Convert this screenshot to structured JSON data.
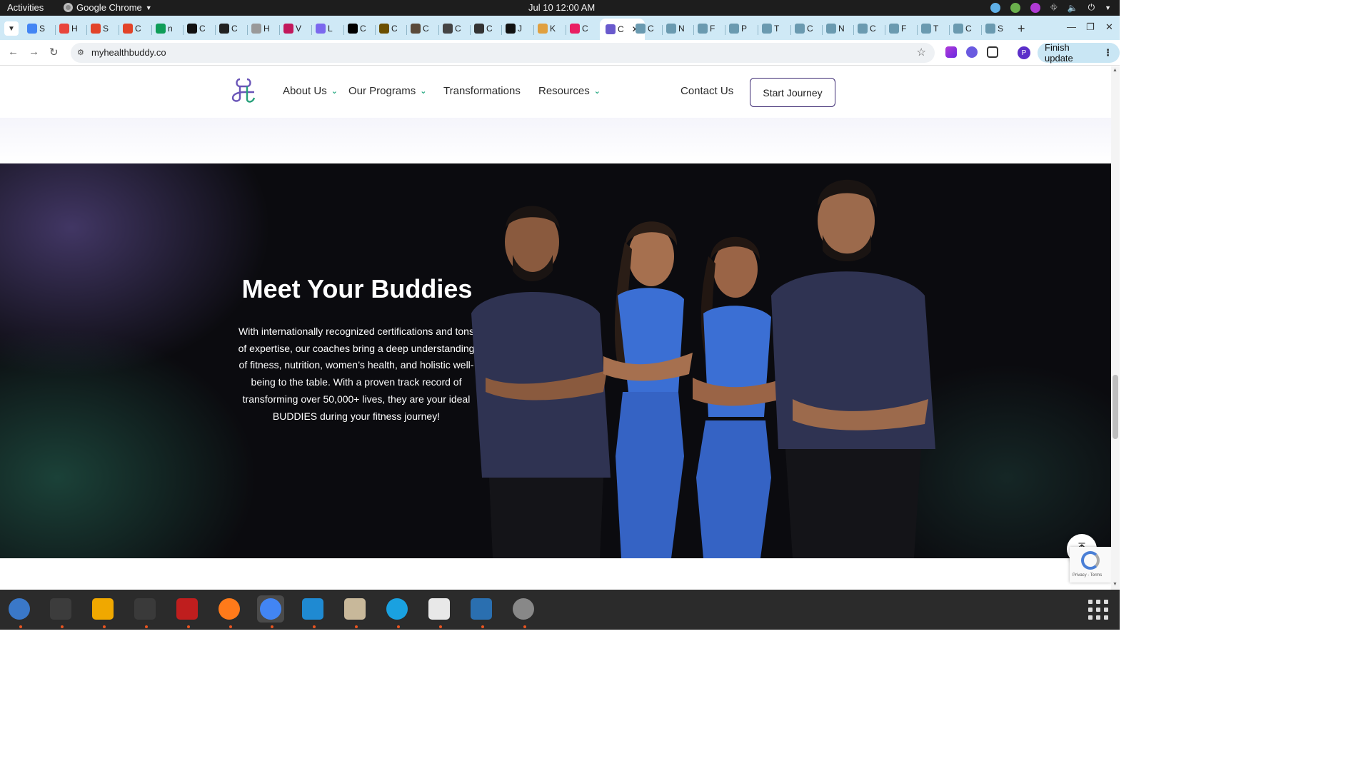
{
  "system": {
    "activities": "Activities",
    "app_menu": "Google Chrome",
    "clock": "Jul 10  12:00 AM"
  },
  "tabs": [
    {
      "letter": "S",
      "color": "#4285f4"
    },
    {
      "letter": "H",
      "color": "#e8453c"
    },
    {
      "letter": "S",
      "color": "#e24329"
    },
    {
      "letter": "C",
      "color": "#e24329"
    },
    {
      "letter": "n",
      "color": "#0f9d58"
    },
    {
      "letter": "C",
      "color": "#111111"
    },
    {
      "letter": "C",
      "color": "#222222"
    },
    {
      "letter": "H",
      "color": "#999999"
    },
    {
      "letter": "V",
      "color": "#c2185b"
    },
    {
      "letter": "L",
      "color": "#7b68ee"
    },
    {
      "letter": "C",
      "color": "#000000"
    },
    {
      "letter": "C",
      "color": "#6b4f00"
    },
    {
      "letter": "C",
      "color": "#5a4a3a"
    },
    {
      "letter": "C",
      "color": "#444444"
    },
    {
      "letter": "C",
      "color": "#333333"
    },
    {
      "letter": "J",
      "color": "#111111"
    },
    {
      "letter": "K",
      "color": "#e0a040"
    },
    {
      "letter": "C",
      "color": "#e91e63"
    },
    {
      "letter": "C",
      "color": "#6a5acd",
      "active": true
    },
    {
      "letter": "C",
      "color": "#6a9ab0"
    },
    {
      "letter": "N",
      "color": "#6a9ab0"
    },
    {
      "letter": "F",
      "color": "#6a9ab0"
    },
    {
      "letter": "P",
      "color": "#6a9ab0"
    },
    {
      "letter": "T",
      "color": "#6a9ab0"
    },
    {
      "letter": "C",
      "color": "#6a9ab0"
    },
    {
      "letter": "N",
      "color": "#6a9ab0"
    },
    {
      "letter": "C",
      "color": "#6a9ab0"
    },
    {
      "letter": "F",
      "color": "#6a9ab0"
    },
    {
      "letter": "T",
      "color": "#6a9ab0"
    },
    {
      "letter": "C",
      "color": "#6a9ab0"
    },
    {
      "letter": "S",
      "color": "#6a9ab0"
    }
  ],
  "browser": {
    "url": "myhealthbuddy.co",
    "finish_update": "Finish update",
    "profile_initial": "P"
  },
  "site": {
    "nav": {
      "about": "About Us",
      "programs": "Our Programs",
      "transformations": "Transformations",
      "resources": "Resources",
      "contact": "Contact Us",
      "cta": "Start Journey"
    },
    "hero": {
      "title": "Meet Your Buddies",
      "text": "With internationally recognized certifications and tons of expertise, our coaches bring a deep understanding of fitness, nutrition, women’s health, and holistic well-being to the table. With a proven track record of transforming over 50,000+ lives, they are your ideal BUDDIES during your fitness journey!"
    },
    "recaptcha": "Privacy - Terms"
  },
  "colors": {
    "accent_green": "#1aa37a",
    "brand_purple": "#3c2a72",
    "hero_bg": "#0b0b0f",
    "shirt_navy": "#2f3352",
    "sport_blue": "#3b6fd4"
  },
  "dock": [
    {
      "name": "thunderbird",
      "icon": "mail-icon"
    },
    {
      "name": "terminal",
      "icon": "terminal-icon"
    },
    {
      "name": "calculator",
      "icon": "calculator-icon"
    },
    {
      "name": "system-monitor",
      "icon": "monitor-icon"
    },
    {
      "name": "filezilla",
      "icon": "filezilla-icon"
    },
    {
      "name": "firefox",
      "icon": "firefox-icon"
    },
    {
      "name": "chrome",
      "icon": "chrome-icon"
    },
    {
      "name": "vscode",
      "icon": "vscode-icon"
    },
    {
      "name": "files",
      "icon": "folder-icon"
    },
    {
      "name": "skype",
      "icon": "skype-icon"
    },
    {
      "name": "text-editor",
      "icon": "editor-icon"
    },
    {
      "name": "document-viewer",
      "icon": "document-icon"
    },
    {
      "name": "disc",
      "icon": "disc-icon"
    }
  ]
}
